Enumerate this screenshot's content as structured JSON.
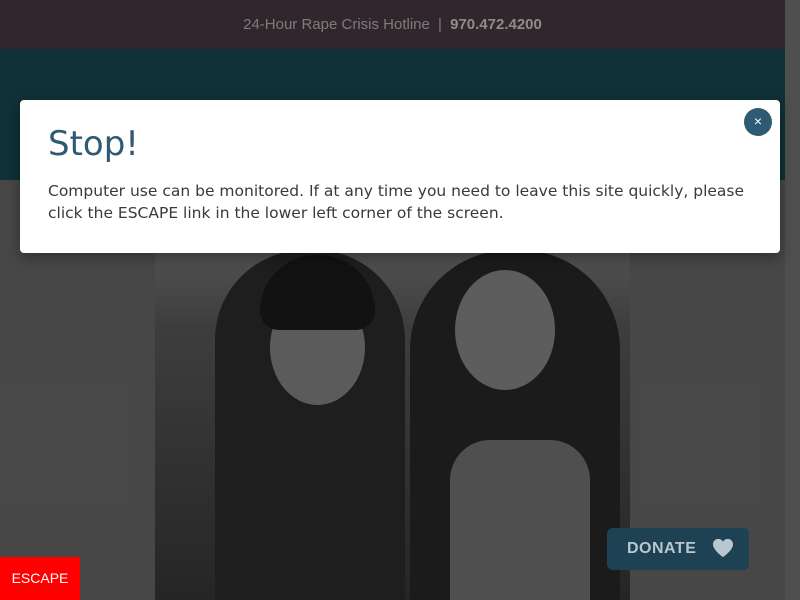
{
  "topbar": {
    "hotline_label": "24-Hour Rape Crisis Hotline",
    "separator": "|",
    "phone": "970.472.4200"
  },
  "modal": {
    "title": "Stop!",
    "body": "Computer use can be monitored. If at any time you need to leave this site quickly, please click the ESCAPE link in the lower left corner of the screen.",
    "close_icon": "×"
  },
  "escape": {
    "label": "ESCAPE"
  },
  "donate": {
    "label": "DONATE",
    "icon": "heart-icon"
  },
  "colors": {
    "topbar_bg": "#4d3b45",
    "header_bg": "#174c55",
    "modal_accent": "#2e5a73",
    "escape_bg": "#ff0000",
    "donate_bg": "#1f4154"
  }
}
